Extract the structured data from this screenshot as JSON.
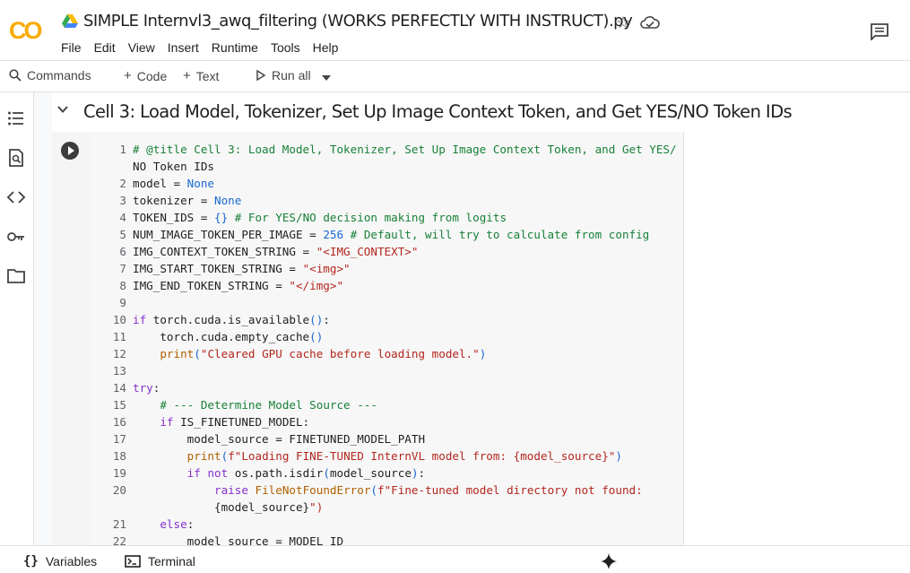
{
  "header": {
    "title": "SIMPLE Internvl3_awq_filtering (WORKS PERFECTLY WITH INSTRUCT).py",
    "logo_text": "CO",
    "menu": [
      "File",
      "Edit",
      "View",
      "Insert",
      "Runtime",
      "Tools",
      "Help"
    ]
  },
  "toolbar": {
    "commands": "Commands",
    "code": "Code",
    "text": "Text",
    "run_all": "Run all"
  },
  "section": {
    "title": "Cell 3: Load Model, Tokenizer, Set Up Image Context Token, and Get YES/NO Token IDs"
  },
  "code_lines": [
    {
      "n": "1",
      "text": "# @title Cell 3: Load Model, Tokenizer, Set Up Image Context Token, and Get YES/"
    },
    {
      "n": "",
      "text": "NO Token IDs"
    },
    {
      "n": "2",
      "text": "model = None"
    },
    {
      "n": "3",
      "text": "tokenizer = None"
    },
    {
      "n": "4",
      "text": "TOKEN_IDS = {} # For YES/NO decision making from logits"
    },
    {
      "n": "5",
      "text": "NUM_IMAGE_TOKEN_PER_IMAGE = 256 # Default, will try to calculate from config"
    },
    {
      "n": "6",
      "text": "IMG_CONTEXT_TOKEN_STRING = \"<IMG_CONTEXT>\""
    },
    {
      "n": "7",
      "text": "IMG_START_TOKEN_STRING = \"<img>\""
    },
    {
      "n": "8",
      "text": "IMG_END_TOKEN_STRING = \"</img>\""
    },
    {
      "n": "9",
      "text": ""
    },
    {
      "n": "10",
      "text": "if torch.cuda.is_available():"
    },
    {
      "n": "11",
      "text": "    torch.cuda.empty_cache()"
    },
    {
      "n": "12",
      "text": "    print(\"Cleared GPU cache before loading model.\")"
    },
    {
      "n": "13",
      "text": ""
    },
    {
      "n": "14",
      "text": "try:"
    },
    {
      "n": "15",
      "text": "    # --- Determine Model Source ---"
    },
    {
      "n": "16",
      "text": "    if IS_FINETUNED_MODEL:"
    },
    {
      "n": "17",
      "text": "        model_source = FINETUNED_MODEL_PATH"
    },
    {
      "n": "18",
      "text": "        print(f\"Loading FINE-TUNED InternVL model from: {model_source}\")"
    },
    {
      "n": "19",
      "text": "        if not os.path.isdir(model_source):"
    },
    {
      "n": "20",
      "text": "            raise FileNotFoundError(f\"Fine-tuned model directory not found:"
    },
    {
      "n": "",
      "text": "            {model_source}\")"
    },
    {
      "n": "21",
      "text": "    else:"
    },
    {
      "n": "22",
      "text": "        model_source = MODEL_ID"
    }
  ],
  "bottom": {
    "variables": "Variables",
    "terminal": "Terminal"
  },
  "colors": {
    "comment": "#188038",
    "keyword": "#8430ce",
    "string": "#b3261e",
    "builtin": "#b06000",
    "number": "#1967d2",
    "logo_orange": "#f9ab00",
    "logo_dark_orange": "#e8710a"
  },
  "icons": [
    "drive-icon",
    "star-icon",
    "cloud-icon",
    "comment-icon",
    "search-icon",
    "plus-icon",
    "play-icon",
    "dropdown-icon",
    "toc-icon",
    "find-icon",
    "code-icon",
    "key-icon",
    "folder-icon",
    "chevron-down-icon",
    "braces-icon",
    "terminal-icon",
    "sparkle-icon"
  ]
}
